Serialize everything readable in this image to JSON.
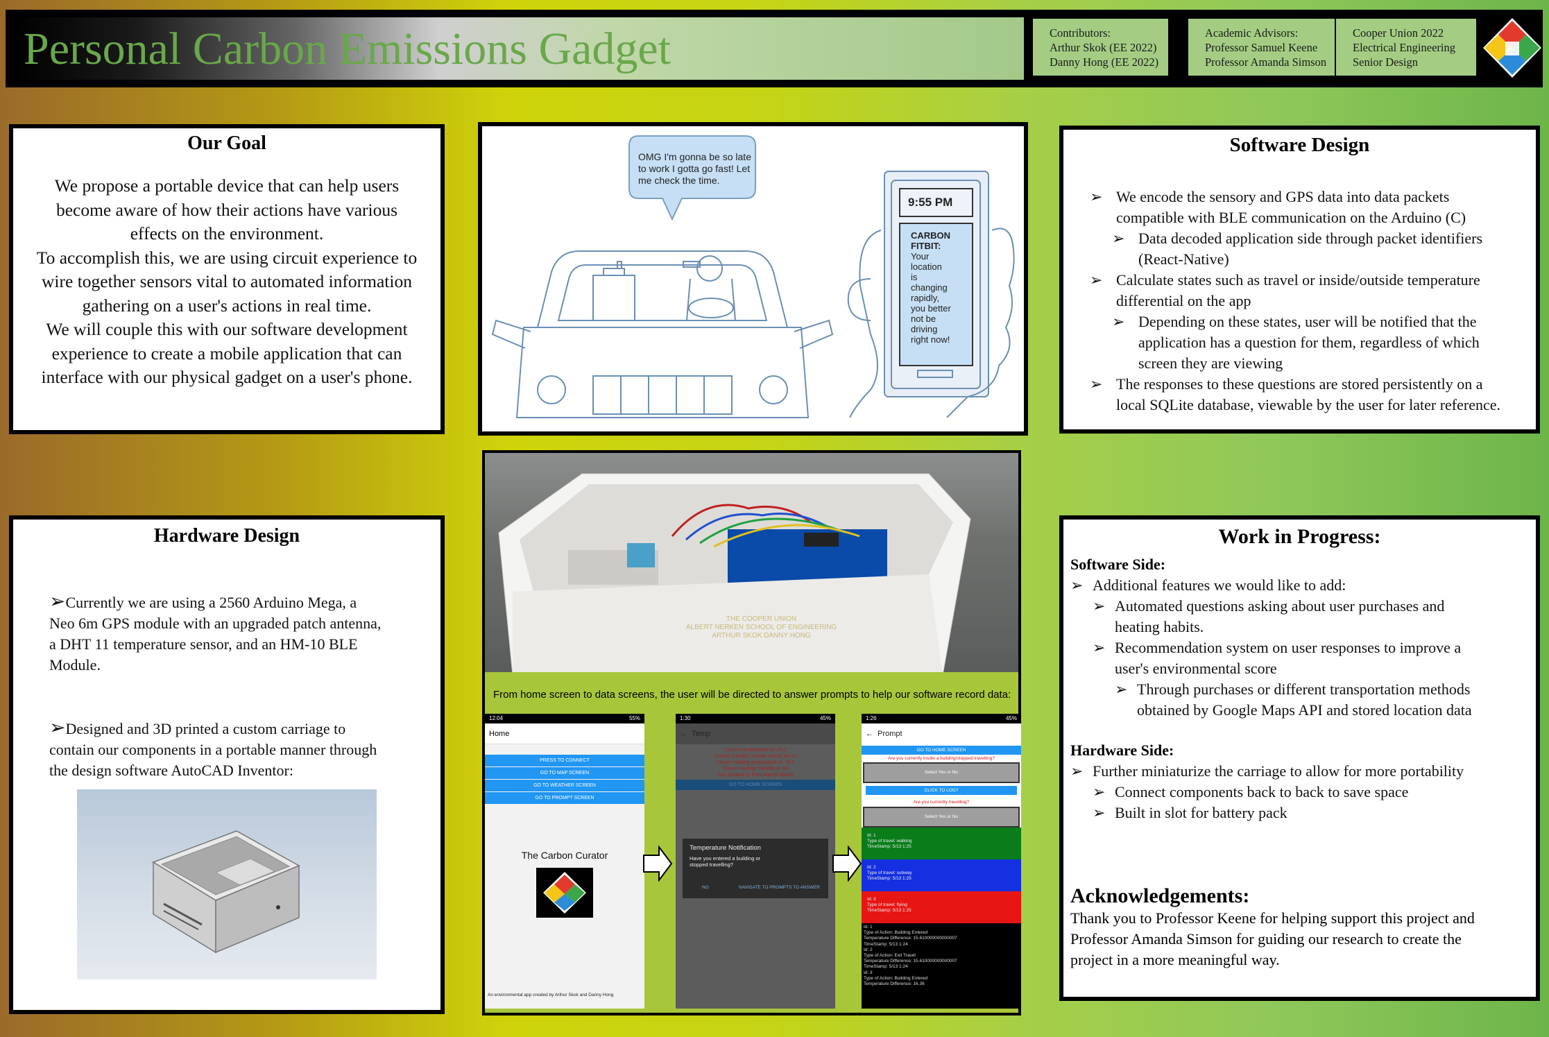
{
  "header": {
    "title": "Personal Carbon Emissions Gadget",
    "contributors": [
      "Contributors:",
      "Arthur Skok (EE 2022)",
      "Danny Hong (EE 2022)"
    ],
    "advisors": [
      "Academic Advisors:",
      "Professor Samuel Keene",
      "Professor Amanda Simson"
    ],
    "school": [
      "Cooper Union 2022",
      "Electrical Engineering",
      "Senior Design"
    ],
    "logo_colors": [
      "#e23b2e",
      "#f5c518",
      "#2e8bd8",
      "#3aa84a",
      "#ffffff"
    ]
  },
  "goal": {
    "heading": "Our Goal",
    "lines": [
      "We propose a portable device that can help users",
      "become aware of  how their actions have various",
      "effects on the environment.",
      "To accomplish this, we are using circuit experience to",
      "wire together sensors vital to automated information",
      "gathering on a user's actions in real time.",
      "We will couple this with our software development",
      "experience to create a mobile application that can",
      "interface with our physical gadget on a user's phone."
    ]
  },
  "cartoon": {
    "speech": [
      "OMG I'm gonna be so late",
      "to work I gotta go fast! Let",
      "me check the time."
    ],
    "time": "9:55 PM",
    "notice": [
      "CARBON",
      "FITBIT:",
      "Your",
      "location",
      "is",
      "changing",
      "rapidly,",
      "you better",
      "not be",
      "driving",
      "right now!"
    ]
  },
  "software": {
    "heading": "Software Design",
    "items": [
      {
        "level": 1,
        "text": [
          "We encode the sensory and GPS data into data packets",
          "compatible with BLE communication on the Arduino (C)"
        ]
      },
      {
        "level": 2,
        "text": [
          "Data decoded application side through packet identifiers",
          "(React-Native)"
        ]
      },
      {
        "level": 1,
        "text": [
          "Calculate states such as travel or inside/outside temperature",
          "differential on the app"
        ]
      },
      {
        "level": 2,
        "text": [
          "Depending on these states, user will be notified that the",
          "application has a question for them, regardless of which",
          "screen they are viewing"
        ]
      },
      {
        "level": 1,
        "text": [
          "The responses to these questions are stored persistently on a",
          "local SQLite database, viewable by the user for later reference."
        ]
      }
    ]
  },
  "hardware": {
    "heading": "Hardware Design",
    "p1": [
      "Currently we are using a 2560 Arduino Mega, a",
      "Neo 6m GPS module with an upgraded patch antenna,",
      "a DHT 11 temperature sensor, and an HM-10 BLE",
      "Module."
    ],
    "p2": [
      "Designed and 3D printed a custom carriage to",
      "contain our components in a portable manner through",
      "the design software AutoCAD Inventor:"
    ]
  },
  "photo": {
    "engraving": [
      "THE COOPER UNION",
      "ALBERT NERKEN SCHOOL OF ENGINEERING",
      "ARTHUR SKOK DANNY HONG"
    ]
  },
  "screens": {
    "caption": "From home screen to data screens, the user will be directed to answer prompts to help our software record data:",
    "home": {
      "status": "12:04",
      "battery": "55%",
      "title": "Home",
      "buttons": [
        "PRESS TO CONNECT",
        "GO TO MAP SCREEN",
        "GO TO WEATHER SCREEN",
        "GO TO PROMPT SCREEN"
      ],
      "app_name": "The Carbon Curator",
      "footer": "An environmental app created by Arthur Skok and Danny Hong"
    },
    "temp": {
      "status": "1:30",
      "battery": "45%",
      "title": "Temp",
      "readings": [
        "Current temperature is: 26.2",
        "Current humidity outside should be: 61",
        "Sensor reading temperature is: 78.3",
        "Sensor reading humidity is: 64",
        "Your location is: East Atlantic Beach"
      ],
      "home_button": "GO TO HOME SCREEN",
      "dialog_title": "Temperature Notification",
      "dialog_body": "Have you entered a building or stopped travelling?",
      "btn_no": "NO",
      "btn_nav": "NAVIGATE TO PROMPTS TO ANSWER"
    },
    "prompt": {
      "status": "1:26",
      "battery": "45%",
      "title": "Prompt",
      "home_button": "GO TO HOME SCREEN",
      "q1": "Are you currently inside a building/stopped travelling?",
      "select1": "Select Yes or No",
      "log_button": "CLICK TO LOG?",
      "q2": "Are you currently travelling?",
      "select2": "Select Yes or No",
      "entries": [
        {
          "id": "Id: 1",
          "type": "Type of travel: walking",
          "ts": "TimeStamp: 5/13 1:25",
          "color": "#0a7d1a"
        },
        {
          "id": "Id: 2",
          "type": "Type of travel: subway",
          "ts": "TimeStamp: 5/13 1:25",
          "color": "#1530e0"
        },
        {
          "id": "Id: 3",
          "type": "Type of travel: flying",
          "ts": "TimeStamp: 5/13 1:25",
          "color": "#e81515"
        }
      ],
      "log": [
        "Id: 1",
        "Type of Action: Building Entered",
        "Temperature Difference: 15.610000000000007",
        "TimeStamp: 5/13 1:24",
        "Id: 2",
        "Type of Action: Exit Travel",
        "Temperature Difference: 15.610000000000007",
        "TimeStamp: 5/13 1:24",
        "Id: 3",
        "Type of Action: Building Entered",
        "Temperature Difference: 16.36"
      ]
    }
  },
  "progress": {
    "heading": "Work in Progress:",
    "software_label": "Software Side:",
    "software_items": [
      {
        "level": 1,
        "text": [
          "Additional features we would like to add:"
        ]
      },
      {
        "level": 2,
        "text": [
          "Automated questions asking about user purchases and",
          "heating habits."
        ]
      },
      {
        "level": 2,
        "text": [
          "Recommendation system on user responses to improve a",
          "user's environmental score"
        ]
      },
      {
        "level": 3,
        "text": [
          "Through purchases or different transportation methods",
          "obtained by Google Maps API and stored location data"
        ]
      }
    ],
    "hardware_label": "Hardware Side:",
    "hardware_items": [
      {
        "level": 1,
        "text": [
          "Further miniaturize the carriage to allow for more portability"
        ]
      },
      {
        "level": 2,
        "text": [
          "Connect components back to back to save space"
        ]
      },
      {
        "level": 2,
        "text": [
          "Built in slot for battery pack"
        ]
      }
    ],
    "ack_heading": "Acknowledgements:",
    "ack_lines": [
      "Thank you to Professor Keene for helping support this project and",
      "Professor Amanda Simson for guiding our research to create the",
      "project in a more meaningful way."
    ]
  }
}
